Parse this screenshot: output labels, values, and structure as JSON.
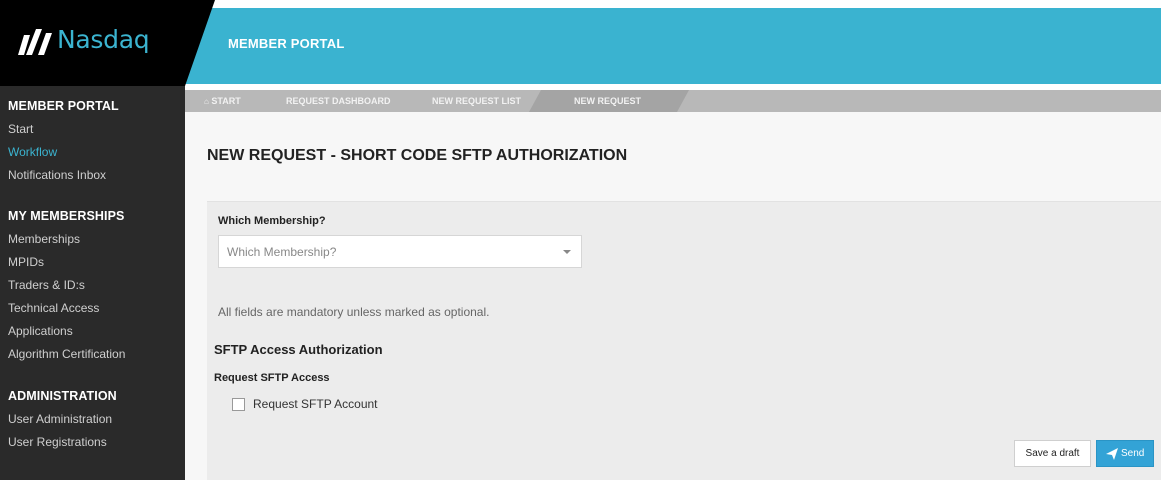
{
  "brand": {
    "logo_text": "Nasdaq",
    "accent": "#3ab3d0"
  },
  "header": {
    "title": "MEMBER PORTAL"
  },
  "sidebar": {
    "sections": [
      {
        "heading": "MEMBER PORTAL",
        "items": [
          {
            "label": "Start",
            "active": false
          },
          {
            "label": "Workflow",
            "active": true
          },
          {
            "label": "Notifications Inbox",
            "active": false
          }
        ]
      },
      {
        "heading": "MY MEMBERSHIPS",
        "items": [
          {
            "label": "Memberships"
          },
          {
            "label": "MPIDs"
          },
          {
            "label": "Traders & ID:s"
          },
          {
            "label": "Technical Access"
          },
          {
            "label": "Applications"
          },
          {
            "label": "Algorithm Certification"
          }
        ]
      },
      {
        "heading": "ADMINISTRATION",
        "items": [
          {
            "label": "User Administration"
          },
          {
            "label": "User Registrations"
          }
        ]
      }
    ]
  },
  "breadcrumb": {
    "items": [
      {
        "label": "START",
        "icon": "home-icon"
      },
      {
        "label": "REQUEST DASHBOARD"
      },
      {
        "label": "NEW REQUEST LIST"
      },
      {
        "label": "NEW REQUEST",
        "active": true
      }
    ]
  },
  "main": {
    "page_title": "NEW REQUEST - SHORT CODE SFTP AUTHORIZATION",
    "membership_label": "Which Membership?",
    "membership_placeholder": "Which Membership?",
    "mandatory_note": "All fields are mandatory unless marked as optional.",
    "section_title": "SFTP Access Authorization",
    "sub_title": "Request SFTP Access",
    "checkbox_label": "Request SFTP Account",
    "checkbox_checked": false,
    "draft_button": "Save a draft",
    "send_button": "Send"
  }
}
